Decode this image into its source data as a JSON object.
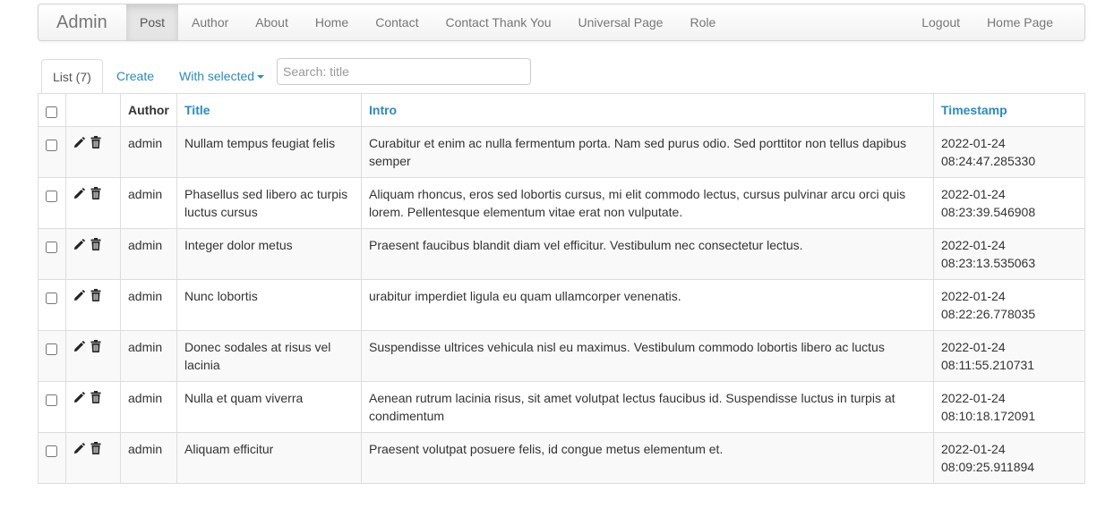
{
  "navbar": {
    "brand": "Admin",
    "left_items": [
      {
        "label": "Post",
        "active": true
      },
      {
        "label": "Author"
      },
      {
        "label": "About"
      },
      {
        "label": "Home"
      },
      {
        "label": "Contact"
      },
      {
        "label": "Contact Thank You"
      },
      {
        "label": "Universal Page"
      },
      {
        "label": "Role"
      }
    ],
    "right_items": [
      {
        "label": "Logout"
      },
      {
        "label": "Home Page"
      }
    ]
  },
  "tabs": {
    "list_label": "List (7)",
    "create_label": "Create",
    "with_selected_label": "With selected"
  },
  "search": {
    "placeholder": "Search: title",
    "value": ""
  },
  "table": {
    "headers": {
      "author": "Author",
      "title": "Title",
      "intro": "Intro",
      "timestamp": "Timestamp"
    },
    "rows": [
      {
        "author": "admin",
        "title": "Nullam tempus feugiat felis",
        "intro": "Curabitur et enim ac nulla fermentum porta. Nam sed purus odio. Sed porttitor non tellus dapibus semper",
        "date": "2022-01-24",
        "time": "08:24:47.285330"
      },
      {
        "author": "admin",
        "title": "Phasellus sed libero ac turpis luctus cursus",
        "intro": "Aliquam rhoncus, eros sed lobortis cursus, mi elit commodo lectus, cursus pulvinar arcu orci quis lorem. Pellentesque elementum vitae erat non vulputate.",
        "date": "2022-01-24",
        "time": "08:23:39.546908"
      },
      {
        "author": "admin",
        "title": "Integer dolor metus",
        "intro": "Praesent faucibus blandit diam vel efficitur. Vestibulum nec consectetur lectus.",
        "date": "2022-01-24",
        "time": "08:23:13.535063"
      },
      {
        "author": "admin",
        "title": "Nunc lobortis",
        "intro": "urabitur imperdiet ligula eu quam ullamcorper venenatis.",
        "date": "2022-01-24",
        "time": "08:22:26.778035"
      },
      {
        "author": "admin",
        "title": "Donec sodales at risus vel lacinia",
        "intro": "Suspendisse ultrices vehicula nisl eu maximus. Vestibulum commodo lobortis libero ac luctus",
        "date": "2022-01-24",
        "time": "08:11:55.210731"
      },
      {
        "author": "admin",
        "title": "Nulla et quam viverra",
        "intro": "Aenean rutrum lacinia risus, sit amet volutpat lectus faucibus id. Suspendisse luctus in turpis at condimentum",
        "date": "2022-01-24",
        "time": "08:10:18.172091"
      },
      {
        "author": "admin",
        "title": "Aliquam efficitur",
        "intro": "Praesent volutpat posuere felis, id congue metus elementum et.",
        "date": "2022-01-24",
        "time": "08:09:25.911894"
      }
    ]
  },
  "icons": {
    "edit": "pencil-icon",
    "delete": "trash-icon"
  },
  "colors": {
    "link": "#2a8ac4",
    "nav_text": "#777777",
    "row_stripe": "#f9f9f9",
    "border": "#dddddd"
  }
}
